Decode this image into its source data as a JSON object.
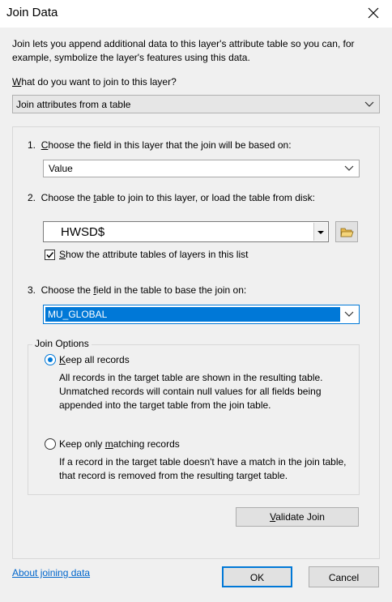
{
  "window": {
    "title": "Join Data"
  },
  "description": "Join lets you append additional data to this layer's attribute table so you can, for example, symbolize the layer's features using this data.",
  "join_type": {
    "label": "What do you want to join to this layer?",
    "selected": "Join attributes from a table"
  },
  "step1": {
    "number": "1.",
    "label": "Choose the field in this layer that the join will be based on:",
    "selected": "Value"
  },
  "step2": {
    "number": "2.",
    "label": "Choose the table to join to this layer, or load the table from disk:",
    "selected": "HWSD$",
    "show_tables_label": "Show the attribute tables of layers in this list",
    "show_tables_checked": true
  },
  "step3": {
    "number": "3.",
    "label": "Choose the field in the table to base the join on:",
    "selected": "MU_GLOBAL"
  },
  "join_options": {
    "title": "Join Options",
    "keep_all": {
      "label": "Keep all records",
      "selected": true,
      "description": "All records in the target table are shown in the resulting table. Unmatched records will contain null values for all fields being appended into the target table from the join table."
    },
    "keep_matching": {
      "label": "Keep only matching records",
      "selected": false,
      "description": "If a record in the target table doesn't have a match in the join table, that record is removed from the resulting target table."
    }
  },
  "buttons": {
    "validate": "Validate Join",
    "ok": "OK",
    "cancel": "Cancel"
  },
  "about_link": "About joining data",
  "colors": {
    "selection": "#0078d7",
    "link": "#0066cc"
  },
  "icons": {
    "close": "close-icon",
    "dropdown": "chevron-down-icon",
    "open_folder": "open-folder-icon"
  }
}
